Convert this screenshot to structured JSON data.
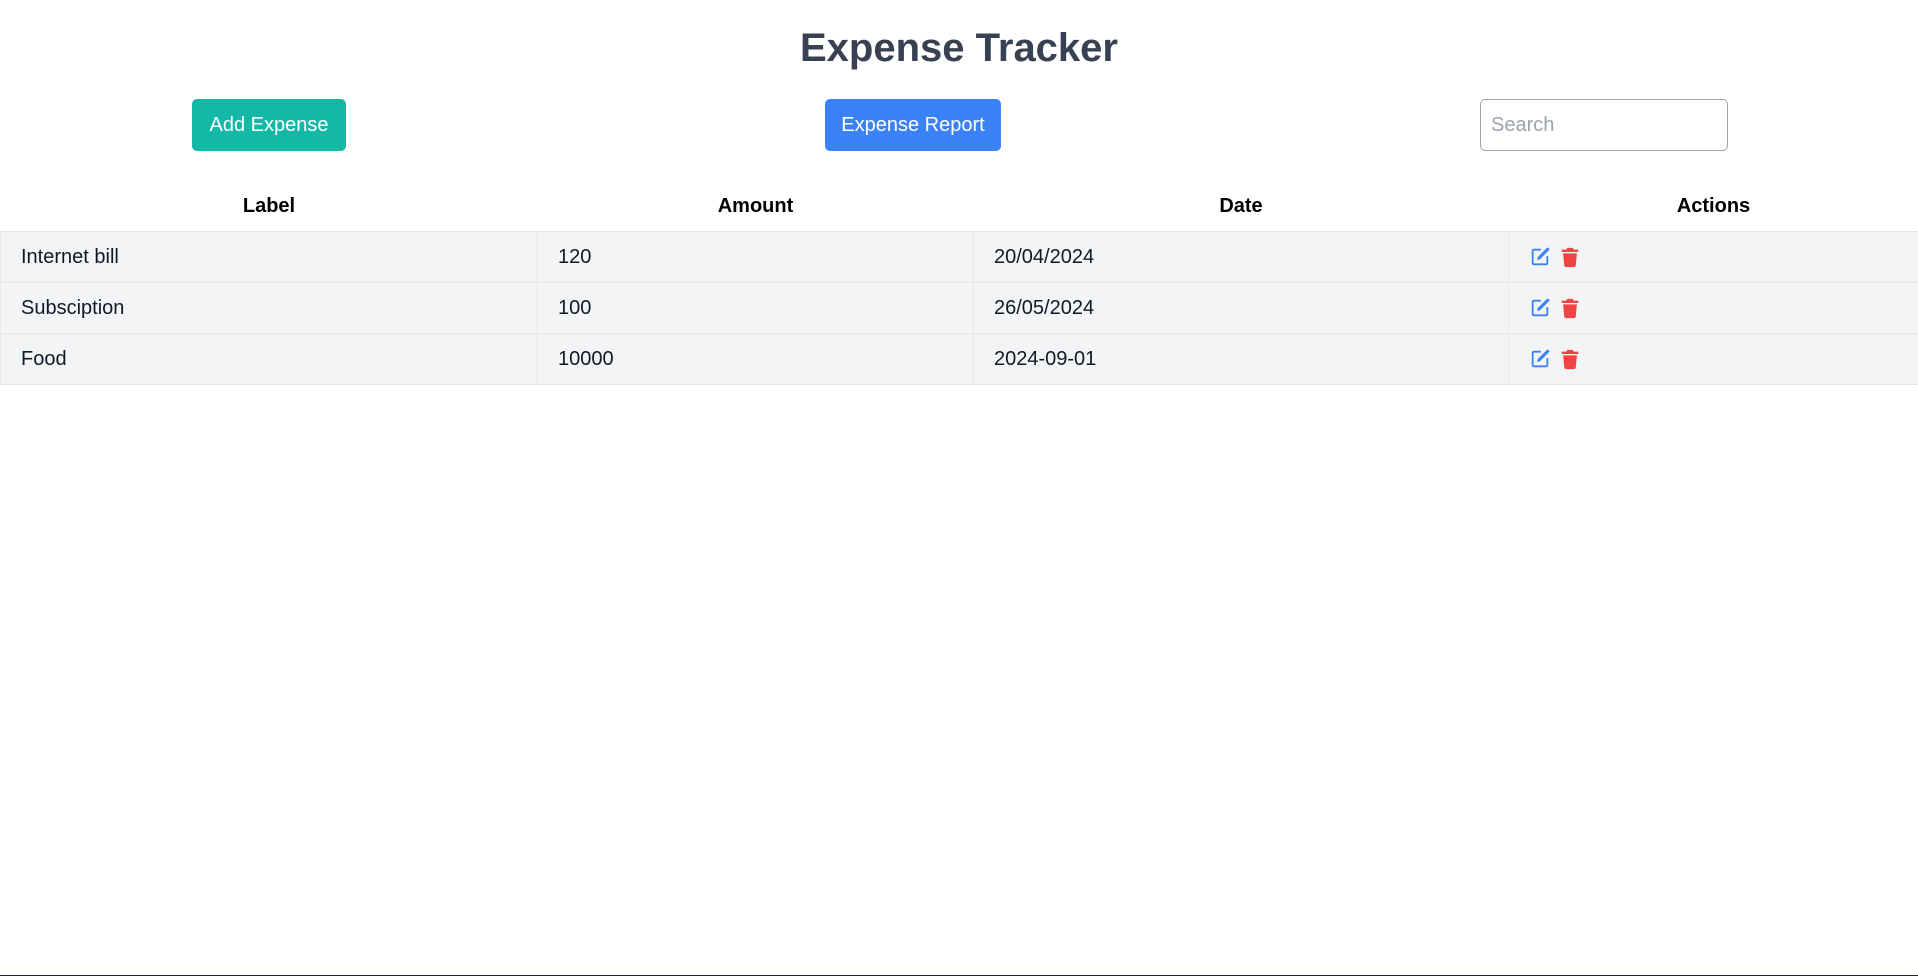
{
  "header": {
    "title": "Expense Tracker"
  },
  "toolbar": {
    "add_label": "Add Expense",
    "report_label": "Expense Report",
    "search_placeholder": "Search",
    "search_value": ""
  },
  "table": {
    "columns": [
      "Label",
      "Amount",
      "Date",
      "Actions"
    ],
    "rows": [
      {
        "label": "Internet bill",
        "amount": "120",
        "date": "20/04/2024"
      },
      {
        "label": "Subsciption",
        "amount": "100",
        "date": "26/05/2024"
      },
      {
        "label": "Food",
        "amount": "10000",
        "date": "2024-09-01"
      }
    ],
    "actions": {
      "edit_icon": "edit-icon",
      "delete_icon": "trash-icon"
    }
  },
  "colors": {
    "title": "#374151",
    "add_button": "#14b8a6",
    "report_button": "#3b82f6",
    "edit_icon": "#3b82f6",
    "delete_icon": "#ef4444",
    "row_background": "#f3f4f6"
  }
}
